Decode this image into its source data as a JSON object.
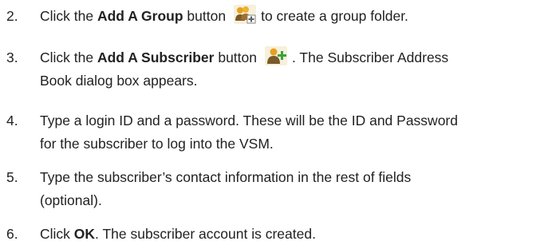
{
  "steps": [
    {
      "number": "2.",
      "pre": "Click the ",
      "bold": "Add A Group",
      "post_icon_before": " button",
      "icon": "add-group-icon",
      "post": "to create a group folder."
    },
    {
      "number": "3.",
      "pre": "Click the ",
      "bold": "Add A Subscriber",
      "post_icon_before": " button",
      "icon": "add-subscriber-icon",
      "post_line1": ". The Subscriber Address",
      "post_line2": "Book dialog box appears."
    },
    {
      "number": "4.",
      "line1": "Type a login ID and a password. These will be the ID and Password",
      "line2": "for the subscriber to log into the VSM."
    },
    {
      "number": "5.",
      "line1": "Type the subscriber’s contact information in the rest of fields",
      "line2": "(optional)."
    },
    {
      "number": "6.",
      "pre": "Click ",
      "bold": "OK",
      "post": ". The subscriber account is created."
    }
  ],
  "colors": {
    "text": "#222222",
    "icon_head": "#e8a020",
    "icon_body": "#7a5a2a",
    "icon_plus": "#3aa23a"
  }
}
